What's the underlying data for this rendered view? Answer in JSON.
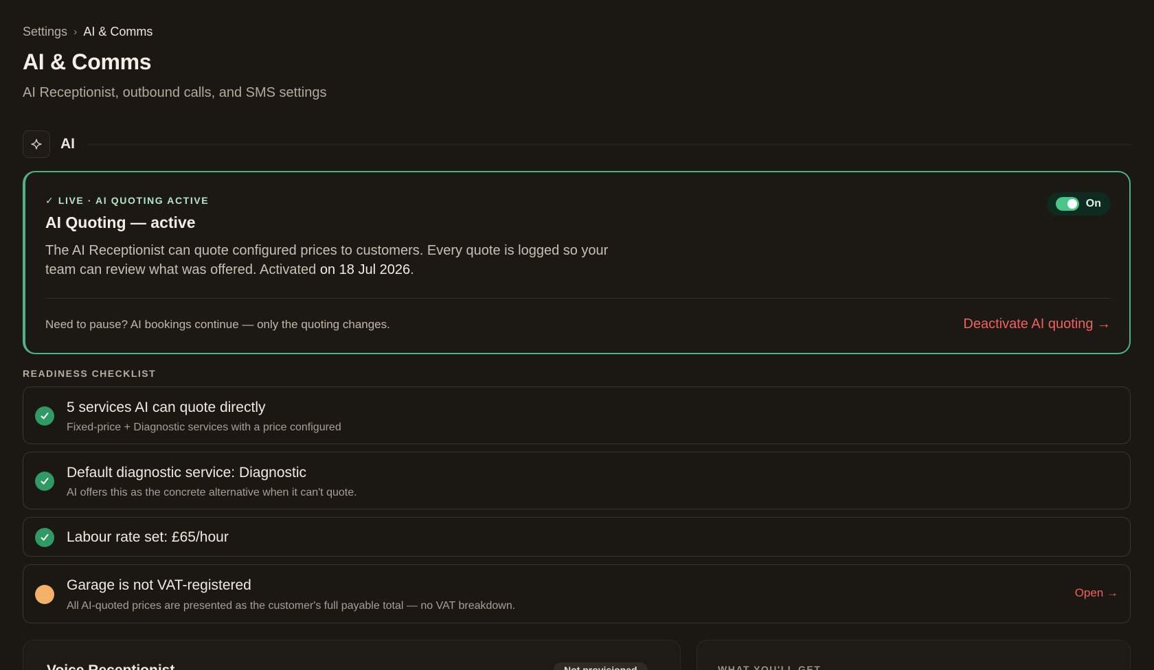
{
  "breadcrumb": {
    "parent": "Settings",
    "separator": "›",
    "current": "AI & Comms"
  },
  "header": {
    "title": "AI & Comms",
    "subtitle": "AI Receptionist, outbound calls, and SMS settings"
  },
  "section": {
    "title": "AI",
    "icon": "sparkle-icon"
  },
  "ai_quoting": {
    "tag": "✓ LIVE · AI QUOTING ACTIVE",
    "title": "AI Quoting — active",
    "description": "The AI Receptionist can quote configured prices to customers. Every quote is logged so your team can review what was offered. Activated",
    "activated_date": "on 18 Jul 2026",
    "description_end": ".",
    "toggle_label": "On",
    "toggle_on": true,
    "pause_note": "Need to pause? AI bookings continue — only the quoting changes.",
    "deactivate_label": "Deactivate AI quoting →"
  },
  "checklist": {
    "label": "READINESS CHECKLIST",
    "items": [
      {
        "status": "ok",
        "title": "5 services AI can quote directly",
        "subtitle": "Fixed-price + Diagnostic services with a price configured"
      },
      {
        "status": "ok",
        "title": "Default diagnostic service: Diagnostic",
        "subtitle": "AI offers this as the concrete alternative when it can't quote."
      },
      {
        "status": "ok",
        "title": "Labour rate set: £65/hour"
      },
      {
        "status": "warn",
        "title": "Garage is not VAT-registered",
        "subtitle": "All AI-quoted prices are presented as the customer's full payable total — no VAT breakdown.",
        "action": "Open →"
      }
    ]
  },
  "voice": {
    "title": "Voice Receptionist",
    "badge": "Not provisioned"
  },
  "what_you_get": {
    "label": "WHAT YOU'LL GET"
  },
  "colors": {
    "accent_green": "#4db383",
    "danger": "#f0615c",
    "warning": "#f3b067",
    "background": "#1b1713"
  }
}
